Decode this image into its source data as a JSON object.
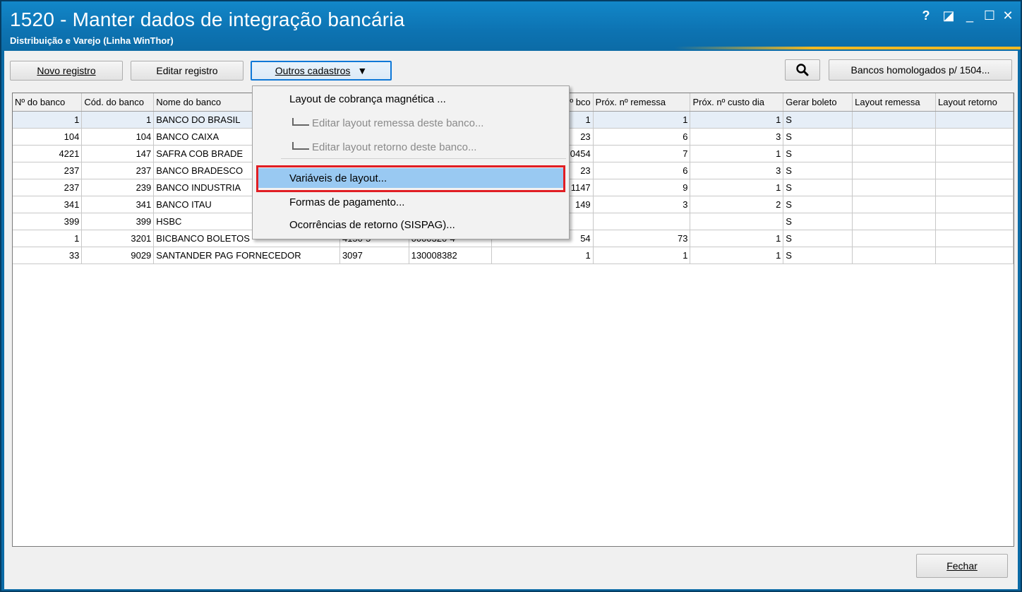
{
  "window": {
    "title": "1520 - Manter dados de integração bancária",
    "subtitle": "Distribuição e Varejo (Linha WinThor)",
    "help": "?",
    "restore": "◪",
    "minimize": "_",
    "maximize": "☐",
    "close": "✕"
  },
  "toolbar": {
    "novo": "Novo registro",
    "editar": "Editar registro",
    "outros": "Outros cadastros",
    "outros_arrow": "▼",
    "bancos": "Bancos homologados p/ 1504..."
  },
  "grid": {
    "headers": [
      "Nº do banco",
      "Cód. do banco",
      "Nome do banco",
      "",
      "",
      "Nº bco",
      "Próx. nº remessa",
      "Próx. nº custo dia",
      "Gerar boleto",
      "Layout remessa",
      "Layout retorno"
    ],
    "rows": [
      [
        "1",
        "1",
        "BANCO DO BRASIL",
        "",
        "",
        "1",
        "1",
        "1",
        "S",
        "",
        ""
      ],
      [
        "104",
        "104",
        "BANCO CAIXA",
        "",
        "",
        "23",
        "6",
        "3",
        "S",
        "",
        ""
      ],
      [
        "4221",
        "147",
        "SAFRA COB BRADE",
        "",
        "",
        "0454",
        "7",
        "1",
        "S",
        "",
        ""
      ],
      [
        "237",
        "237",
        "BANCO BRADESCO",
        "",
        "",
        "23",
        "6",
        "3",
        "S",
        "",
        ""
      ],
      [
        "237",
        "239",
        "BANCO INDUSTRIA",
        "",
        "",
        "1147",
        "9",
        "1",
        "S",
        "",
        ""
      ],
      [
        "341",
        "341",
        "BANCO ITAU",
        "",
        "",
        "149",
        "3",
        "2",
        "S",
        "",
        ""
      ],
      [
        "399",
        "399",
        "HSBC",
        "",
        "",
        "",
        "",
        "",
        "S",
        "",
        ""
      ],
      [
        "1",
        "3201",
        "BICBANCO BOLETOS",
        "4150-5",
        "0000320-4",
        "54",
        "73",
        "1",
        "S",
        "",
        ""
      ],
      [
        "33",
        "9029",
        "SANTANDER PAG FORNECEDOR",
        "3097",
        "130008382",
        "1",
        "1",
        "1",
        "S",
        "",
        ""
      ]
    ]
  },
  "menu": {
    "items": [
      "Layout de cobrança magnética ...",
      "Editar layout remessa deste banco...",
      "Editar layout retorno deste banco...",
      "Variáveis de layout...",
      "Formas de pagamento...",
      "Ocorrências de retorno (SISPAG)..."
    ]
  },
  "footer": {
    "fechar": "Fechar"
  }
}
